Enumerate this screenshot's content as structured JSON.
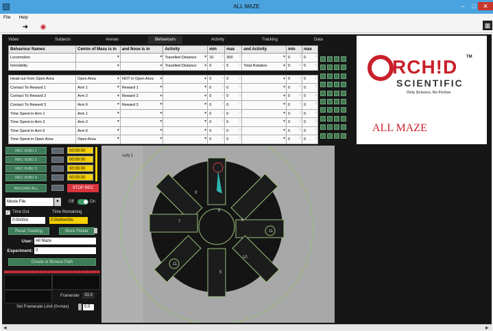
{
  "window": {
    "title": "ALL MAZE",
    "minimize": "–",
    "maximize": "□",
    "close": "✕"
  },
  "menu": {
    "file": "File",
    "help": "Help"
  },
  "toolbar": {
    "arrow_icon": "arrow-right-icon",
    "record_icon": "record-icon"
  },
  "tabs": [
    "Video",
    "Subjects",
    "Arenas",
    "Behaviours",
    "Activity",
    "Tracking",
    "Data"
  ],
  "active_tab": "Behaviours",
  "behaviour_table": {
    "headers": [
      "Behaviour Names",
      "Centre of Mass is in",
      "and Nose is in",
      "Activity",
      "min",
      "max",
      "and Activity",
      "min",
      "max"
    ],
    "rows": [
      [
        "Locomotion",
        "",
        "",
        "Travelled Distance",
        "10",
        "300",
        "",
        "0",
        "0"
      ],
      [
        "Immobility",
        "",
        "",
        "Travelled Distance",
        "0",
        "5",
        "Total Rotation",
        "0",
        "0"
      ],
      [
        "Head out from Open Area",
        "Open Area",
        "NOT in Open Area",
        "",
        "0",
        "0",
        "",
        "0",
        "0"
      ],
      [
        "Contact To Reward 1",
        "Arm 1",
        "Reward 1",
        "",
        "0",
        "0",
        "",
        "0",
        "0"
      ],
      [
        "Contact To Reward 2",
        "Arm 2",
        "Reward 2",
        "",
        "0",
        "0",
        "",
        "0",
        "0"
      ],
      [
        "Contact To Reward 3",
        "Arm 6",
        "Reward 3",
        "",
        "0",
        "0",
        "",
        "0",
        "0"
      ],
      [
        "Time Spent in Arm 1",
        "Arm 1",
        "",
        "",
        "0",
        "0",
        "",
        "0",
        "0"
      ],
      [
        "Time Spent in Arm 2",
        "Arm 2",
        "",
        "",
        "0",
        "0",
        "",
        "0",
        "0"
      ],
      [
        "Time Spent in Arm 6",
        "Arm 6",
        "",
        "",
        "0",
        "0",
        "",
        "0",
        "0"
      ],
      [
        "Time Spent in Open Area",
        "Open Area",
        "",
        "",
        "0",
        "0",
        "",
        "0",
        "0"
      ]
    ]
  },
  "logo": {
    "brand_rchid": "RCH!D",
    "tm": "TM",
    "scientific": "SCIENTIFIC",
    "tagline": "Only Science, No Fiction",
    "product": "ALL MAZE"
  },
  "recording": {
    "rec_buttons": [
      "REC SUBJ 1",
      "REC SUBJ 2",
      "REC SUBJ 3",
      "REC SUBJ 4"
    ],
    "times": [
      "00:00:00",
      "00:00:00",
      "00:00:00",
      "00:00:00"
    ],
    "record_all": "RECORD ALL",
    "stop_rec": "STOP REC"
  },
  "source": {
    "selected": "Movie File",
    "off": "Off",
    "on": "On"
  },
  "timing": {
    "timeout_label": "Time Out",
    "timeout_checked": "✓",
    "timeout_value": "0:0h00m",
    "remaining_label": "Time Remaining",
    "remaining_value": "0:0h00m00s"
  },
  "actions": {
    "reset": "Reset Tracking",
    "block": "Block Flicker"
  },
  "experiment": {
    "user_label": "User:",
    "user_value": "All Maze",
    "exp_label": "Experiment:",
    "exp_value": "0",
    "create_button": "Create or Browse Path"
  },
  "framerate": {
    "label": "Framerate",
    "value": "33.3",
    "set_label": "Set Framerate Limit (0=max)",
    "set_value": "0.0"
  },
  "video": {
    "subject_label": "subj 1",
    "arm_labels": [
      "9",
      "7",
      "8",
      "6",
      "5",
      "11",
      "11",
      "10"
    ]
  },
  "colors": {
    "accent_green": "#3e7b58",
    "stop_red": "#d8343e",
    "time_yellow": "#f5d000",
    "brand_red": "#c8202a",
    "titlebar_blue": "#4aa3df"
  }
}
